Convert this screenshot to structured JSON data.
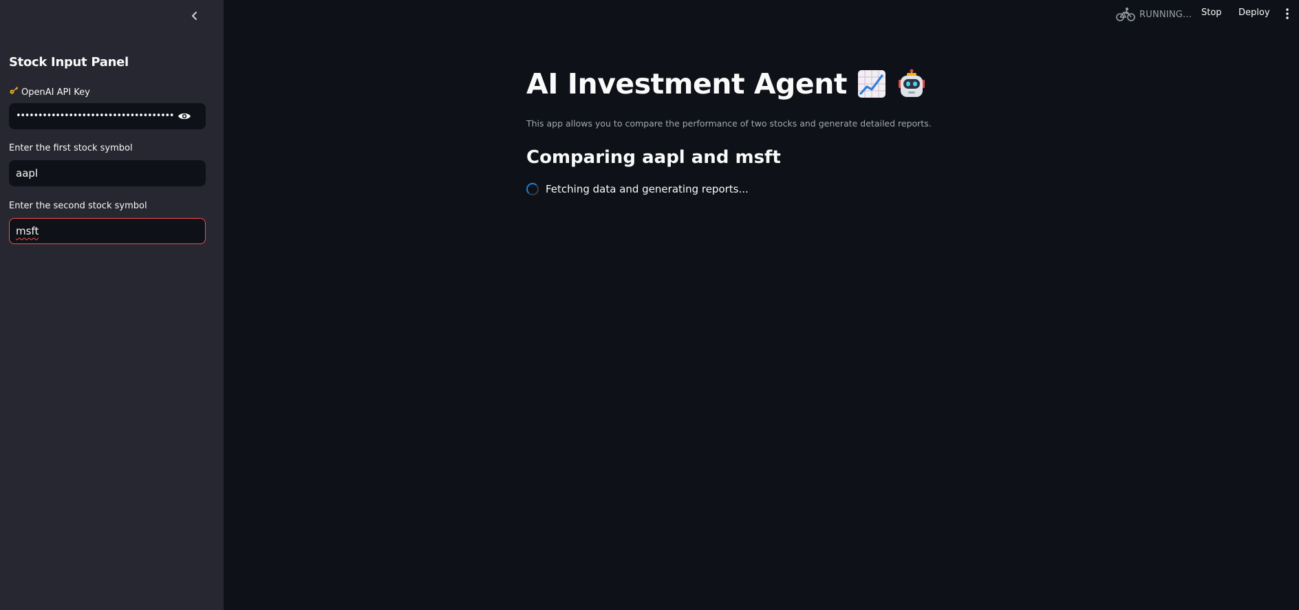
{
  "sidebar": {
    "title": "Stock Input Panel",
    "collapse_icon": "chevron-left-icon",
    "api_key": {
      "label": "OpenAI API Key",
      "label_icon": "key-icon",
      "value_masked": "••••••••••••••••••••••••••••••••••••••••••••••••••",
      "reveal_icon": "eye-icon"
    },
    "first_stock": {
      "label": "Enter the first stock symbol",
      "value": "aapl"
    },
    "second_stock": {
      "label": "Enter the second stock symbol",
      "value": "msft"
    }
  },
  "header": {
    "status_icon": "running-cyclist-icon",
    "status_text": "RUNNING...",
    "stop_label": "Stop",
    "deploy_label": "Deploy",
    "menu_icon": "kebab-menu-icon"
  },
  "main": {
    "title": "AI Investment Agent",
    "title_emojis": [
      "chart-increasing-icon",
      "robot-icon"
    ],
    "subtitle": "This app allows you to compare the performance of two stocks and generate detailed reports.",
    "section_heading": "Comparing aapl and msft",
    "spinner_text": "Fetching data and generating reports..."
  },
  "colors": {
    "app_background": "#0e1117",
    "sidebar_background": "#262730",
    "focus_border": "#ff4b4b",
    "spinner_accent": "#1c83e1",
    "muted_text": "#a3a8b4"
  }
}
